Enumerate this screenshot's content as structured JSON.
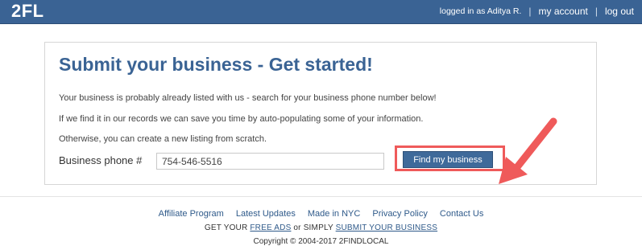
{
  "header": {
    "logo": "2FL",
    "logged_in_text": "logged in as Aditya R.",
    "separator": "|",
    "my_account": "my account",
    "log_out": "log out"
  },
  "main": {
    "title": "Submit your business - Get started!",
    "p1": "Your business is probably already listed with us - search for your business phone number below!",
    "p2": "If we find it in our records we can save you time by auto-populating some of your information.",
    "p3": "Otherwise, you can create a new listing from scratch.",
    "phone_label": "Business phone #",
    "phone_value": "754-546-5516",
    "find_button": "Find my business"
  },
  "annotation": {
    "arrow_color": "#ef5a5a",
    "highlight_color": "#ef5a5a"
  },
  "footer": {
    "links": [
      "Affiliate Program",
      "Latest Updates",
      "Made in NYC",
      "Privacy Policy",
      "Contact Us"
    ],
    "line2_prefix": "GET YOUR",
    "free_ads": "FREE ADS",
    "line2_middle": "or SIMPLY",
    "submit_business": "SUBMIT YOUR BUSINESS",
    "copyright": "Copyright © 2004-2017 2FINDLOCAL"
  },
  "colors": {
    "header_bg": "#3a6394",
    "title": "#3a6394",
    "button_bg": "#3f6a9a",
    "link": "#2f5a8a"
  }
}
